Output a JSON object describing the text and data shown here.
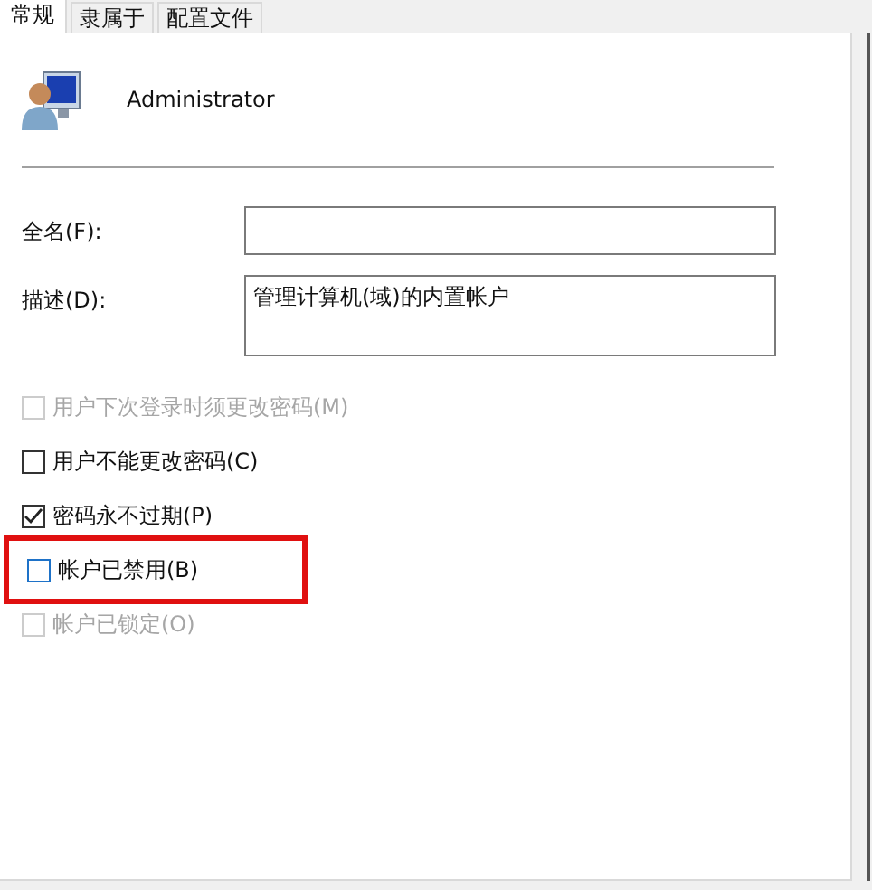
{
  "tabs": [
    {
      "label": "常规",
      "selected": true
    },
    {
      "label": "隶属于",
      "selected": false
    },
    {
      "label": "配置文件",
      "selected": false
    }
  ],
  "user": {
    "name": "Administrator"
  },
  "fields": [
    {
      "label": "全名(F):",
      "multiline": false
    },
    {
      "label": "描述(D):",
      "value": "管理计算机(域)的内置帐户",
      "multiline": true
    }
  ],
  "options": [
    {
      "label": "用户下次登录时须更改密码(M)",
      "checked": false,
      "disabled": true,
      "highlighted": false
    },
    {
      "label": "用户不能更改密码(C)",
      "checked": false,
      "disabled": false,
      "highlighted": false
    },
    {
      "label": "密码永不过期(P)",
      "checked": true,
      "disabled": false,
      "highlighted": false
    },
    {
      "label": "帐户已禁用(B)",
      "checked": false,
      "disabled": false,
      "highlighted": true
    },
    {
      "label": "帐户已锁定(O)",
      "checked": false,
      "disabled": true,
      "highlighted": false
    }
  ]
}
